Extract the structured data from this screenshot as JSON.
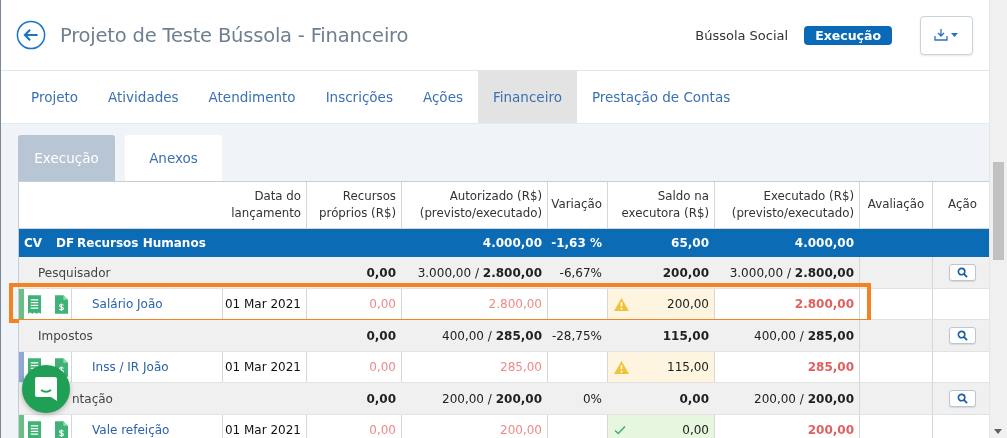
{
  "header": {
    "title": "Projeto de Teste Bússola - Financeiro",
    "organization": "Bússola Social",
    "status_badge": "Execução"
  },
  "tabs": [
    {
      "label": "Projeto",
      "selected": false
    },
    {
      "label": "Atividades",
      "selected": false
    },
    {
      "label": "Atendimento",
      "selected": false
    },
    {
      "label": "Inscrições",
      "selected": false
    },
    {
      "label": "Ações",
      "selected": false
    },
    {
      "label": "Financeiro",
      "selected": true
    },
    {
      "label": "Prestação de Contas",
      "selected": false
    }
  ],
  "subtabs": [
    {
      "label": "Execução",
      "selected": true
    },
    {
      "label": "Anexos",
      "selected": false
    }
  ],
  "table": {
    "columns": [
      "Data do lançamento",
      "Recursos próprios (R$)",
      "Autorizado (R$) (previsto/executado)",
      "Variação",
      "Saldo na executora (R$)",
      "Executado (R$) (previsto/executado)",
      "Avaliação",
      "Ação"
    ],
    "category": {
      "cv": "CV",
      "df": "DF",
      "name": "Recursos Humanos",
      "autorizado": "4.000,00",
      "variacao": "-1,63 %",
      "saldo": "65,00",
      "executado": "4.000,00"
    },
    "rows": [
      {
        "kind": "group",
        "label": "Pesquisador",
        "hidden_start": false,
        "recursos": "0,00",
        "autorizado": "3.000,00 / **2.800,00**",
        "variacao": "-6,67%",
        "saldo": "200,00",
        "executado": "3.000,00 / **2.800,00**"
      },
      {
        "kind": "item",
        "name": "Salário João",
        "color": "#6cbf84",
        "highlighted": true,
        "date": "01 Mar 2021",
        "recursos": "0,00",
        "autorizado": "2.800,00",
        "saldo": "200,00",
        "warning": true,
        "executado": "2.800,00"
      },
      {
        "kind": "group",
        "label": "Impostos",
        "hidden_start": false,
        "recursos": "0,00",
        "autorizado": "400,00 / **285,00**",
        "variacao": "-28,75%",
        "saldo": "115,00",
        "executado": "400,00 / **285,00**"
      },
      {
        "kind": "item",
        "name": "Inss / IR João",
        "color": "#8fa8d8",
        "highlighted": false,
        "date": "01 Mar 2021",
        "recursos": "0,00",
        "autorizado": "285,00",
        "saldo": "115,00",
        "warning": true,
        "executado": "285,00"
      },
      {
        "kind": "group",
        "label": "ntação",
        "hidden_start": true,
        "recursos": "0,00",
        "autorizado": "200,00 / **200,00**",
        "variacao": "0%",
        "saldo": "0,00",
        "executado": "200,00 / **200,00**"
      },
      {
        "kind": "item",
        "name": "Vale refeição",
        "color": "#6cbf84",
        "highlighted": false,
        "date": "01 Mar 2021",
        "recursos": "0,00",
        "autorizado": "200,00",
        "saldo": "0,00",
        "warning": false,
        "executado": "200,00"
      }
    ]
  }
}
